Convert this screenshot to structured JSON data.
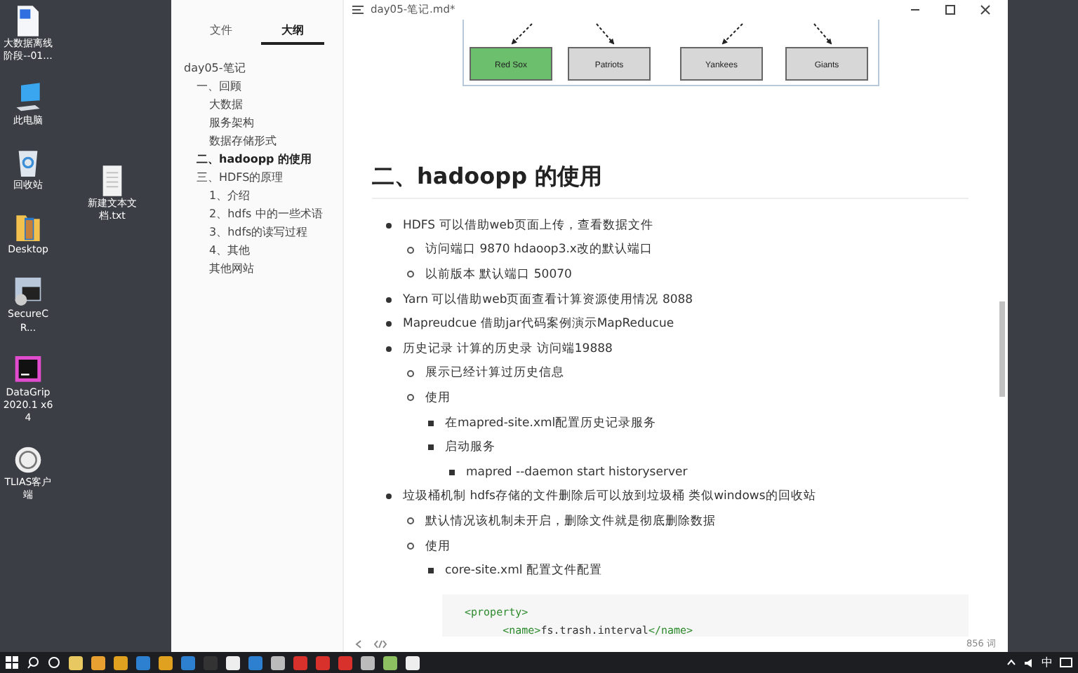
{
  "desktop": {
    "column_1": [
      {
        "kind": "wps-doc",
        "label": "大数据离线阶段--01..."
      },
      {
        "kind": "computer",
        "label": "此电脑"
      },
      {
        "kind": "recycle",
        "label": "回收站"
      },
      {
        "kind": "folder",
        "label": "Desktop"
      },
      {
        "kind": "terminal-app",
        "label": "SecureCR..."
      },
      {
        "kind": "dg-app",
        "label": "DataGrip 2020.1 x64"
      },
      {
        "kind": "round-app",
        "label": "TLIAS客户端"
      }
    ],
    "column_2": [
      {
        "kind": "text-file",
        "label": "新建文本文档.txt"
      }
    ]
  },
  "sidebar": {
    "tabs": [
      {
        "label": "文件",
        "selected": false
      },
      {
        "label": "大纲",
        "selected": true
      }
    ],
    "outline": [
      {
        "label": "day05-笔记",
        "selected": false,
        "children": [
          {
            "label": "一、回顾",
            "selected": false,
            "children": [
              {
                "label": "大数据",
                "selected": false
              },
              {
                "label": "服务架构",
                "selected": false
              },
              {
                "label": "数据存储形式",
                "selected": false
              }
            ]
          },
          {
            "label": "二、hadoopp 的使用",
            "selected": true
          },
          {
            "label": "三、HDFS的原理",
            "selected": false,
            "children": [
              {
                "label": "1、介绍",
                "selected": false
              },
              {
                "label": "2、hdfs 中的一些术语",
                "selected": false
              },
              {
                "label": "3、hdfs的读写过程",
                "selected": false
              },
              {
                "label": "4、其他",
                "selected": false
              },
              {
                "label": "其他网站",
                "selected": false
              }
            ]
          }
        ]
      }
    ]
  },
  "window": {
    "title": "day05-笔记.md*"
  },
  "diagram": {
    "boxes": [
      {
        "label": "Red Sox",
        "highlighted": true
      },
      {
        "label": "Patriots",
        "highlighted": false
      },
      {
        "label": "Yankees",
        "highlighted": false
      },
      {
        "label": "Giants",
        "highlighted": false
      }
    ]
  },
  "heading": "二、hadoopp 的使用",
  "list": [
    {
      "text": "HDFS 可以借助web页面上传，查看数据文件",
      "children": [
        {
          "text": "访问端口 9870  hdaoop3.x改的默认端口"
        },
        {
          "text": "以前版本 默认端口  50070"
        }
      ]
    },
    {
      "text": "Yarn  可以借助web页面查看计算资源使用情况   8088"
    },
    {
      "text": "Mapreudcue  借助jar代码案例演示MapReducue"
    },
    {
      "text": "历史记录 计算的历史录  访问端19888",
      "children": [
        {
          "text": "展示已经计算过历史信息"
        },
        {
          "text": "使用",
          "children": [
            {
              "text": "在mapred-site.xml配置历史记录服务"
            },
            {
              "text": "启动服务",
              "children": [
                {
                  "text": "mapred --daemon start historyserver"
                }
              ]
            }
          ]
        }
      ]
    },
    {
      "text": "垃圾桶机制  hdfs存储的文件删除后可以放到垃圾桶 类似windows的回收站",
      "children": [
        {
          "text": "默认情况该机制未开启，删除文件就是彻底删除数据"
        },
        {
          "text": "使用",
          "children": [
            {
              "text": "core-site.xml 配置文件配置"
            }
          ]
        }
      ]
    }
  ],
  "code": [
    "<property>",
    "      <name>fs.trash.interval</name>"
  ],
  "status_bar": {
    "word_count": "856 词"
  },
  "taskbar": {
    "apps": [
      {
        "kind": "yellow"
      },
      {
        "kind": "folder"
      },
      {
        "kind": "orange"
      },
      {
        "kind": "blue"
      },
      {
        "kind": "orange"
      },
      {
        "kind": "blue"
      },
      {
        "kind": "dark"
      },
      {
        "kind": "white"
      },
      {
        "kind": "blue"
      },
      {
        "kind": "grey"
      },
      {
        "kind": "red"
      },
      {
        "kind": "red"
      },
      {
        "kind": "red"
      },
      {
        "kind": "grey"
      },
      {
        "kind": "green"
      },
      {
        "kind": "white"
      }
    ],
    "ime": "中"
  }
}
